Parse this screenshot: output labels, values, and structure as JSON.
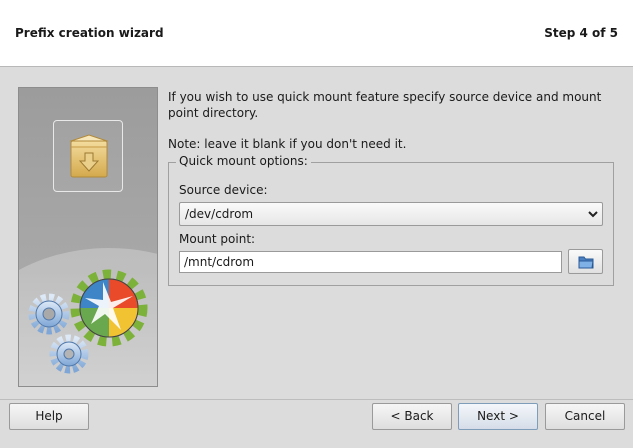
{
  "header": {
    "title": "Prefix creation wizard",
    "step": "Step 4 of 5"
  },
  "content": {
    "intro": "If you wish to use quick mount feature specify source device and mount point directory.",
    "note": "Note: leave it blank if you don't need it."
  },
  "quick_mount": {
    "legend": "Quick mount options:",
    "source_label": "Source device:",
    "source_value": "/dev/cdrom",
    "mount_label": "Mount point:",
    "mount_value": "/mnt/cdrom"
  },
  "buttons": {
    "help": "Help",
    "back": "< Back",
    "next": "Next >",
    "cancel": "Cancel"
  },
  "icons": {
    "package": "package-icon",
    "gears": "gears-logo-icon",
    "folder": "folder-icon",
    "dropdown": "chevron-down-icon"
  }
}
